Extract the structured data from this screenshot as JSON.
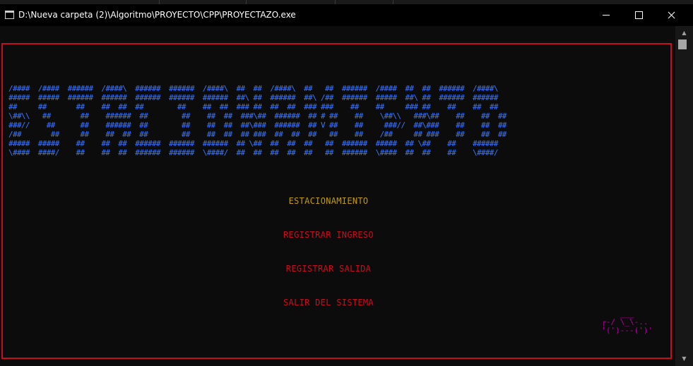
{
  "window": {
    "title": "D:\\Nueva carpeta (2)\\Algoritmo\\PROYECTO\\CPP\\PROYECTAZO.exe",
    "icon": "console-window-icon",
    "controls": [
      "minimize",
      "maximize",
      "close"
    ]
  },
  "console": {
    "banner_lines": [
      "/####  /####  ######  /####\\  ######  ######  /####\\  ##  ##  /####\\  ##   ##  ######  /####  ##  ##  ######  /####\\",
      "#####  #####  ######  ######  ######  ######  ######  ##\\ ##  ######  ##\\ /##  ######  #####  ##\\ ##  ######  ######",
      "##     ##       ##    ##  ##  ##        ##    ##  ##  ### ##  ##  ##  ### ###    ##    ##     ### ##    ##    ##  ##",
      "\\##\\\\   ##       ##    ######  ##        ##    ##  ##  ###\\##  ######  ## # ##    ##    \\##\\\\   ###\\##    ##    ##  ##",
      "###//    ##      ##    ######  ##        ##    ##  ##  ##\\###  ######  ## V ##    ##     ###//  ##\\###    ##    ##  ##",
      "/##       ##     ##    ##  ##  ##        ##    ##  ##  ## ###  ##  ##  ##   ##    ##    /##     ## ###    ##    ##  ##",
      "#####  #####    ##    ##  ##  ######  ######  ######  ## \\##  ##  ##  ##   ##  ######  #####  ## \\##    ##    ######",
      "\\####  ####/    ##    ##  ##  ######  ######  \\####/  ##  ##  ##  ##  ##   ##  ######  \\####  ##  ##    ##    \\####/"
    ],
    "menu_title": "ESTACIONAMIENTO",
    "menu_items": [
      "REGISTRAR INGRESO",
      "REGISTRAR SALIDA",
      "SALIR DEL SISTEMA"
    ],
    "car_art": "      ___\n  ┌-/ \\_\\-..\n  '(')---(')'",
    "colors": {
      "background": "#0c0c0c",
      "frame": "#c50f1f",
      "banner": "#3b78ff",
      "title": "#c19c00",
      "items": "#c50f1f",
      "car": "#b4009e"
    }
  }
}
